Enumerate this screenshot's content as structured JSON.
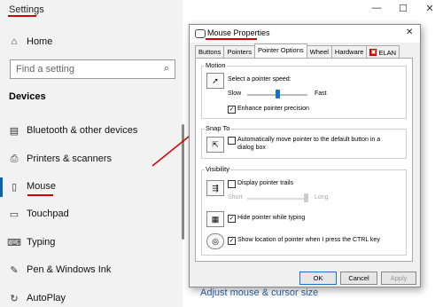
{
  "settings": {
    "title": "Settings",
    "window_controls": {
      "minimize": "—",
      "maximize": "☐",
      "close": "✕"
    },
    "search_placeholder": "Find a setting",
    "home_label": "Home",
    "section_label": "Devices",
    "items": [
      {
        "label": "Bluetooth & other devices",
        "icon": "bluetooth-icon"
      },
      {
        "label": "Printers & scanners",
        "icon": "printer-icon"
      },
      {
        "label": "Mouse",
        "icon": "mouse-icon",
        "selected": true
      },
      {
        "label": "Touchpad",
        "icon": "touchpad-icon"
      },
      {
        "label": "Typing",
        "icon": "keyboard-icon"
      },
      {
        "label": "Pen & Windows Ink",
        "icon": "pen-icon"
      },
      {
        "label": "AutoPlay",
        "icon": "autoplay-icon"
      }
    ],
    "adjust_link": "Adjust mouse & cursor size"
  },
  "dialog": {
    "title": "Mouse Properties",
    "close": "✕",
    "tabs": [
      "Buttons",
      "Pointers",
      "Pointer Options",
      "Wheel",
      "Hardware",
      "ELAN"
    ],
    "active_tab": "Pointer Options",
    "motion": {
      "group_label": "Motion",
      "speed_label": "Select a pointer speed:",
      "slow": "Slow",
      "fast": "Fast",
      "speed_level": 0.5,
      "precision_label": "Enhance pointer precision",
      "precision_checked": true
    },
    "snap": {
      "group_label": "Snap To",
      "label": "Automatically move pointer to the default button in a dialog box",
      "checked": false
    },
    "visibility": {
      "group_label": "Visibility",
      "trails_label": "Display pointer trails",
      "trails_checked": false,
      "short": "Short",
      "long": "Long",
      "hide_label": "Hide pointer while typing",
      "hide_checked": true,
      "ctrl_label": "Show location of pointer when I press the CTRL key",
      "ctrl_checked": true
    },
    "buttons": {
      "ok": "OK",
      "cancel": "Cancel",
      "apply": "Apply"
    }
  },
  "colors": {
    "accent": "#0a64ad",
    "annotation": "#d40000"
  }
}
